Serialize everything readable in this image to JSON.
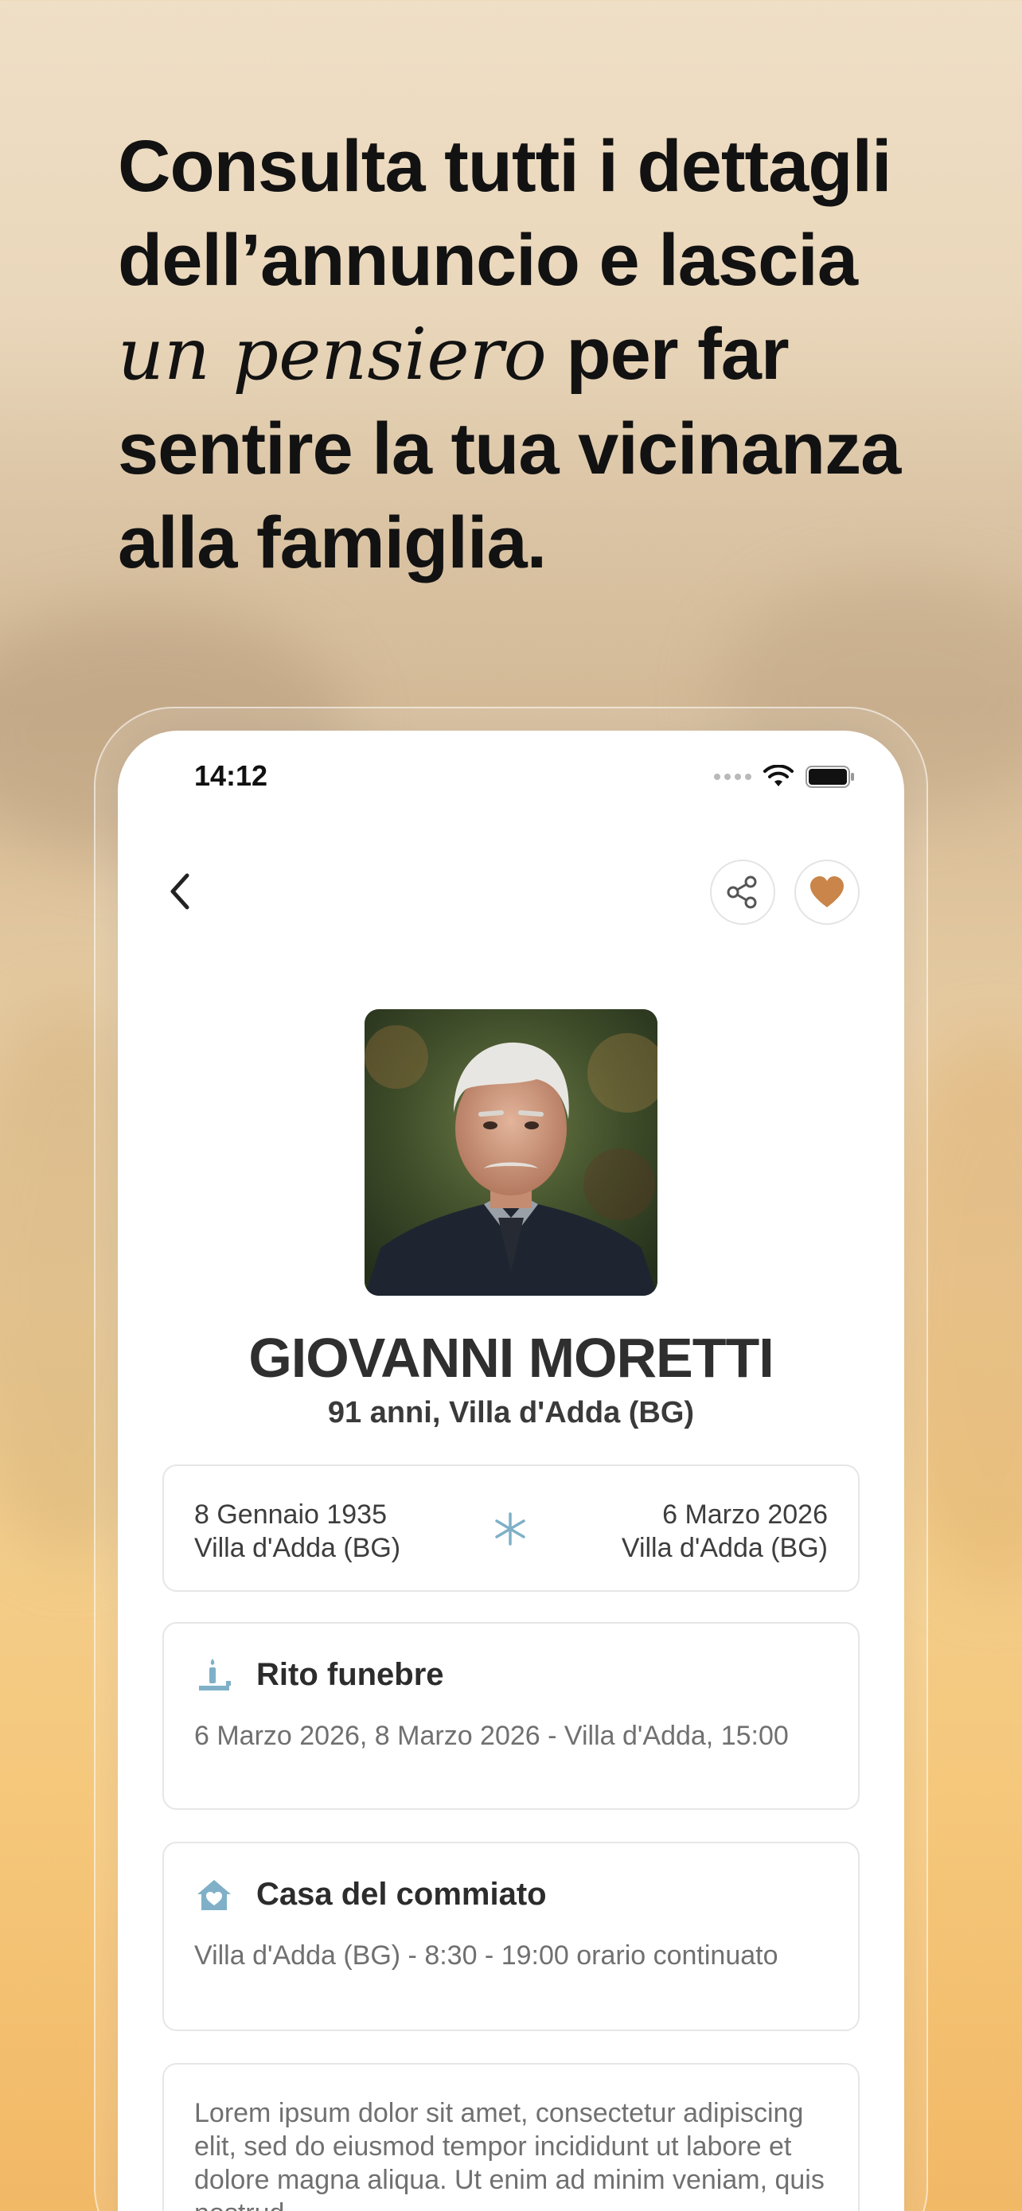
{
  "headline": {
    "line1": "Consulta tutti i dettagli",
    "line2": "dell’annuncio e lascia",
    "italic": "un pensiero",
    "line3_rest": " per far",
    "line4": "sentire la tua vicinanza",
    "line5": "alla famiglia."
  },
  "status_bar": {
    "time": "14:12"
  },
  "header": {
    "back_icon": "chevron-left-icon",
    "share_icon": "share-icon",
    "favorite_icon": "heart-icon",
    "favorite_color": "#c9854a"
  },
  "person": {
    "name": "GIOVANNI MORETTI",
    "age_place": "91 anni, Villa d'Adda (BG)",
    "birth_date": "8 Gennaio 1935",
    "birth_place": "Villa d'Adda (BG)",
    "death_date": "6 Marzo 2026",
    "death_place": "Villa d'Adda (BG)"
  },
  "cards": {
    "rito": {
      "icon": "candle-icon",
      "title": "Rito funebre",
      "body": "6 Marzo 2026, 8 Marzo 2026 - Villa d'Adda, 15:00"
    },
    "casa": {
      "icon": "house-heart-icon",
      "title": "Casa del commiato",
      "body": "Villa d'Adda (BG) - 8:30 - 19:00 orario continuato"
    },
    "lorem": "Lorem ipsum dolor sit amet, consectetur adipiscing elit, sed do eiusmod tempor incididunt ut labore et dolore magna aliqua. Ut enim ad minim veniam, quis nostrud"
  },
  "colors": {
    "accent_blue": "#7fb0c8",
    "heart": "#c9854a"
  }
}
